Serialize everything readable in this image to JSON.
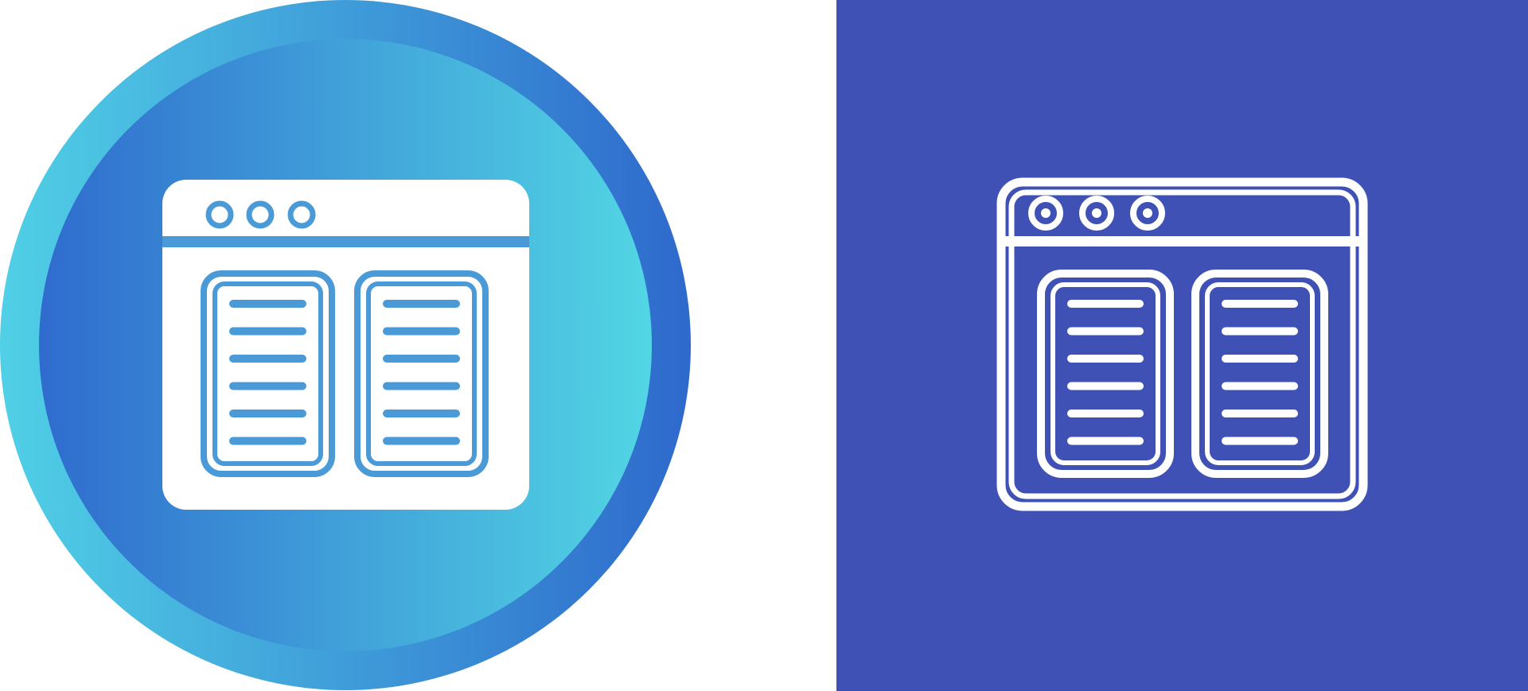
{
  "icons": [
    {
      "variant": "gradient-circle",
      "icon": "browser-window-two-columns-icon",
      "colors": {
        "gradient_outer_start": "#50D0E6",
        "gradient_outer_end": "#2E69CC",
        "gradient_inner_start": "#2F6BCE",
        "gradient_inner_end": "#52D6E4",
        "glyph": "#FFFFFF",
        "glyph_detail": "#4B9AD8"
      }
    },
    {
      "variant": "outline-square",
      "icon": "browser-window-two-columns-outline-icon",
      "colors": {
        "background": "#3F51B5",
        "stroke": "#FFFFFF"
      }
    }
  ]
}
